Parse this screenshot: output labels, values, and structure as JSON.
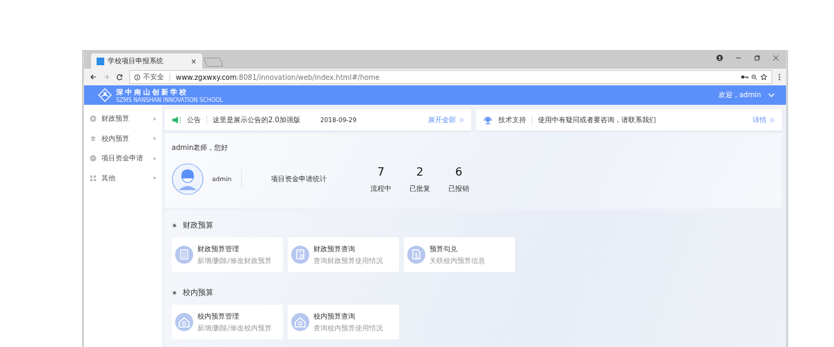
{
  "browser": {
    "tab_title": "学校项目申报系统",
    "tab_close": "×",
    "security_label": "不安全",
    "url_host": "www.zgxwxy.com",
    "url_rest": ":8081/innovation/web/index.html#/home"
  },
  "header": {
    "logo_title": "深中南山创新学校",
    "logo_subtitle": "SZMS NANSHAN INNOVATION SCHOOL",
    "welcome": "欢迎，admin"
  },
  "sidebar": {
    "items": [
      {
        "label": "财政预算"
      },
      {
        "label": "校内预算"
      },
      {
        "label": "项目资金申请"
      },
      {
        "label": "其他"
      }
    ]
  },
  "notices": [
    {
      "title": "公告",
      "text": "这里是展示公告的2.0加强版",
      "date": "2018-09-29",
      "link": "展开全部"
    },
    {
      "title": "技术支持",
      "text": "使用中有疑问或者要咨询，请联系我们",
      "link": "详情"
    }
  ],
  "overview": {
    "greeting": "admin老师，您好",
    "user_name": "admin",
    "stats_label": "项目资金申请统计",
    "stats": [
      {
        "value": "7",
        "label": "流程中"
      },
      {
        "value": "2",
        "label": "已批复"
      },
      {
        "value": "6",
        "label": "已报销"
      }
    ]
  },
  "sections": [
    {
      "title": "财政预算",
      "cards": [
        {
          "title": "财政预算管理",
          "subtitle": "新增/删除/修改财政预算"
        },
        {
          "title": "财政预算查询",
          "subtitle": "查询财政预算使用情况"
        },
        {
          "title": "预算勾兑",
          "subtitle": "关联校内预算信息"
        }
      ]
    },
    {
      "title": "校内预算",
      "cards": [
        {
          "title": "校内预算管理",
          "subtitle": "新增/删除/修改校内预算"
        },
        {
          "title": "校内预算查询",
          "subtitle": "查询校内预算使用情况"
        }
      ]
    }
  ]
}
